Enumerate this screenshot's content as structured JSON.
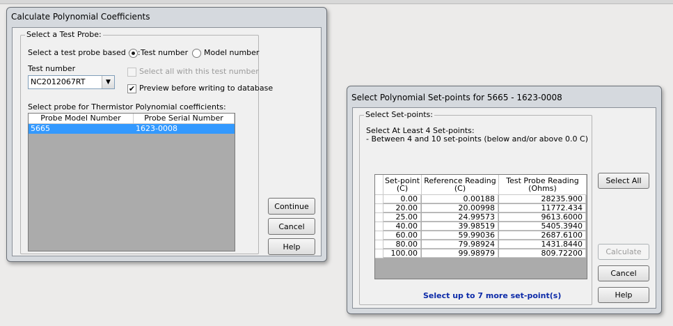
{
  "dialog1": {
    "title": "Calculate Polynomial Coefficients",
    "group_legend": "Select a Test Probe:",
    "select_based_on_label": "Select a test probe based on:",
    "radio_test_number": "Test number",
    "radio_model_number": "Model number",
    "test_number_label": "Test number",
    "test_number_value": "NC2012067RT",
    "select_all_label": "Select all with this test number",
    "preview_label": "Preview before writing to database",
    "probe_list_label": "Select probe for Thermistor Polynomial coefficients:",
    "columns": [
      "Probe Model Number",
      "Probe Serial Number"
    ],
    "rows": [
      [
        "5665",
        "1623-0008"
      ]
    ],
    "continue_button": "Continue",
    "cancel_button": "Cancel",
    "help_button": "Help"
  },
  "dialog2": {
    "title": "Select Polynomial Set-points for 5665 - 1623-0008",
    "group_legend": "Select Set-points:",
    "instruction_line1": "Select At Least 4 Set-points:",
    "instruction_line2": " - Between 4 and 10 set-points (below and/or above 0.0 C)",
    "columns": [
      [
        "Set-point",
        "(C)"
      ],
      [
        "Reference Reading",
        "(C)"
      ],
      [
        "Test Probe Reading",
        "(Ohms)"
      ]
    ],
    "rows": [
      [
        "0.00",
        "0.00188",
        "28235.900"
      ],
      [
        "20.00",
        "20.00998",
        "11772.434"
      ],
      [
        "25.00",
        "24.99573",
        "9613.6000"
      ],
      [
        "40.00",
        "39.98519",
        "5405.3940"
      ],
      [
        "60.00",
        "59.99036",
        "2687.6100"
      ],
      [
        "80.00",
        "79.98924",
        "1431.8440"
      ],
      [
        "100.00",
        "99.98979",
        "809.72200"
      ]
    ],
    "select_all_button": "Select All",
    "calculate_button": "Calculate",
    "cancel_button": "Cancel",
    "help_button": "Help",
    "status_text": "Select up to 7 more set-point(s)"
  }
}
